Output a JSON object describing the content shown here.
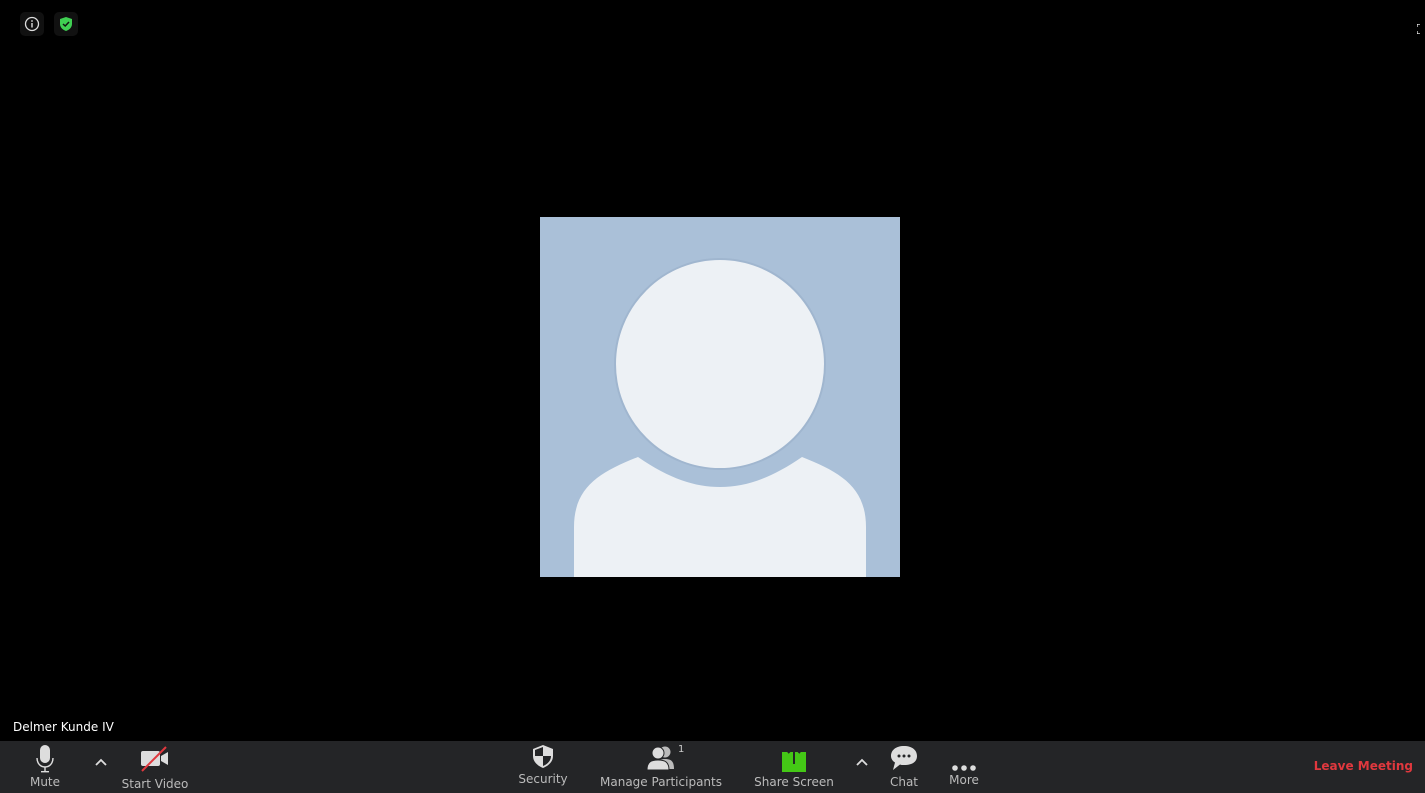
{
  "participant": {
    "name": "Delmer Kunde IV"
  },
  "toolbar": {
    "mute_label": "Mute",
    "video_label": "Start Video",
    "security_label": "Security",
    "participants_label": "Manage Participants",
    "participants_count": "1",
    "share_label": "Share Screen",
    "chat_label": "Chat",
    "more_label": "More",
    "leave_label": "Leave Meeting"
  },
  "colors": {
    "share": "#44c816",
    "leave": "#e0383e",
    "shield": "#3fcf52",
    "avatar_bg": "#aac0d8"
  }
}
